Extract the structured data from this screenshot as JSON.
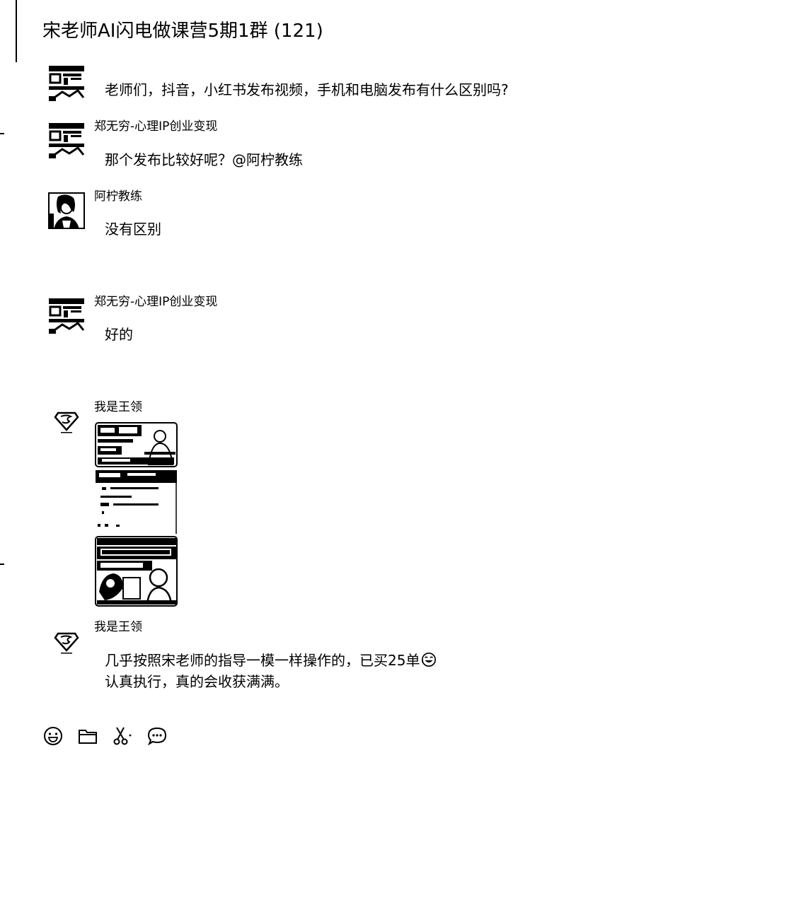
{
  "chat": {
    "title": "宋老师AI闪电做课营5期1群 (121)"
  },
  "messages": [
    {
      "sender": "",
      "avatar": "group-member-avatar",
      "lines": [
        "老师们，抖音，小红书发布视频，手机和电脑发布有什么区别吗?"
      ]
    },
    {
      "sender": "郑无穷-心理IP创业变现",
      "avatar": "group-member-avatar",
      "lines": [
        "那个发布比较好呢？@阿柠教练"
      ]
    },
    {
      "sender": "阿柠教练",
      "avatar": "coach-photo-avatar",
      "lines": [
        "没有区别"
      ]
    },
    {
      "sender": "郑无穷-心理IP创业变现",
      "avatar": "group-member-avatar",
      "lines": [
        "好的"
      ]
    },
    {
      "sender": "我是王领",
      "avatar": "superman-logo-avatar",
      "image": "shared-screenshot-image"
    },
    {
      "sender": "我是王领",
      "avatar": "superman-logo-avatar",
      "lines": [
        "几乎按照宋老师的指导一模一样操作的，已买25单",
        "认真执行，真的会收获满满。"
      ],
      "emoji": "laughing-face-emoji"
    }
  ],
  "toolbar": {
    "icons": [
      "emoji-icon",
      "folder-icon",
      "scissors-icon",
      "chat-bubble-icon"
    ]
  }
}
